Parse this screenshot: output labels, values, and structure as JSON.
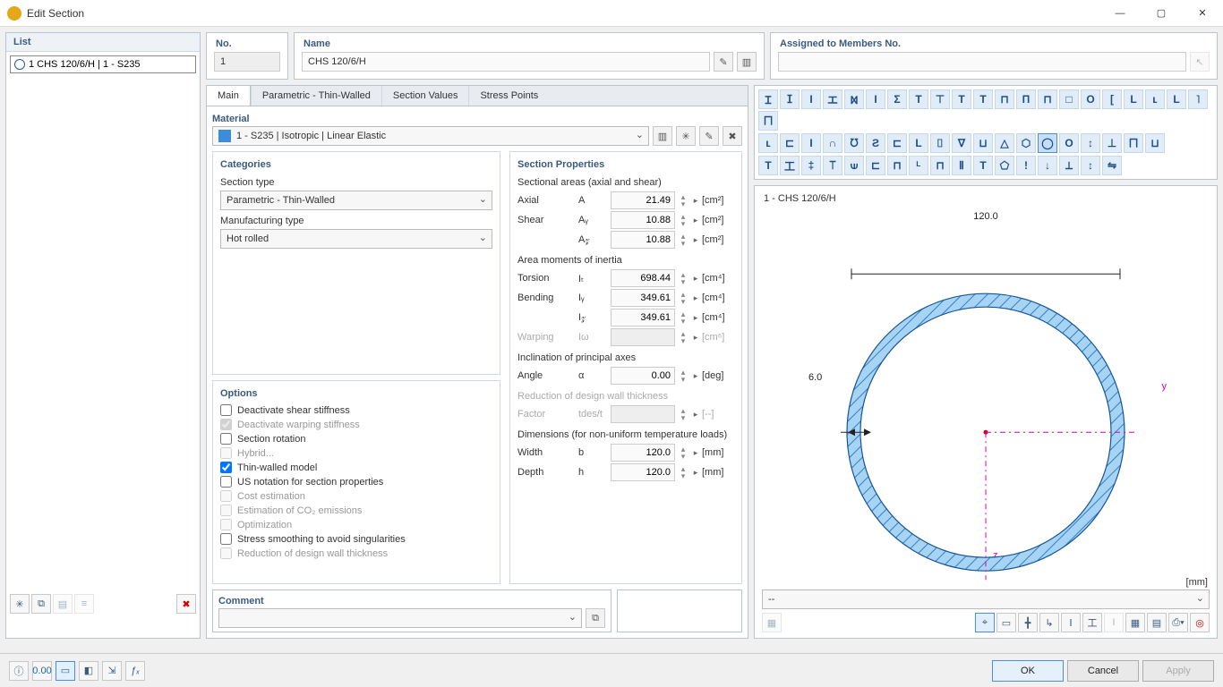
{
  "window": {
    "title": "Edit Section"
  },
  "list": {
    "header": "List",
    "items": [
      "1   CHS 120/6/H | 1 - S235"
    ]
  },
  "no": {
    "label": "No.",
    "value": "1"
  },
  "name": {
    "label": "Name",
    "value": "CHS 120/6/H"
  },
  "assigned": {
    "label": "Assigned to Members No.",
    "value": ""
  },
  "tabs": [
    "Main",
    "Parametric - Thin-Walled",
    "Section Values",
    "Stress Points"
  ],
  "material": {
    "header": "Material",
    "value": "1 - S235 | Isotropic | Linear Elastic"
  },
  "categories": {
    "header": "Categories",
    "section_type": {
      "label": "Section type",
      "value": "Parametric - Thin-Walled"
    },
    "manufacturing": {
      "label": "Manufacturing type",
      "value": "Hot rolled"
    }
  },
  "options": {
    "header": "Options",
    "items": [
      {
        "label": "Deactivate shear stiffness",
        "checked": false,
        "enabled": true
      },
      {
        "label": "Deactivate warping stiffness",
        "checked": true,
        "enabled": false
      },
      {
        "label": "Section rotation",
        "checked": false,
        "enabled": true
      },
      {
        "label": "Hybrid...",
        "checked": false,
        "enabled": false
      },
      {
        "label": "Thin-walled model",
        "checked": true,
        "enabled": true
      },
      {
        "label": "US notation for section properties",
        "checked": false,
        "enabled": true
      },
      {
        "label": "Cost estimation",
        "checked": false,
        "enabled": false
      },
      {
        "label": "Estimation of CO₂ emissions",
        "checked": false,
        "enabled": false
      },
      {
        "label": "Optimization",
        "checked": false,
        "enabled": false
      },
      {
        "label": "Stress smoothing to avoid singularities",
        "checked": false,
        "enabled": true
      },
      {
        "label": "Reduction of design wall thickness",
        "checked": false,
        "enabled": false
      }
    ]
  },
  "properties": {
    "header": "Section Properties",
    "groups": {
      "areas": {
        "title": "Sectional areas (axial and shear)",
        "rows": [
          {
            "label": "Axial",
            "sym": "A",
            "value": "21.49",
            "unit": "[cm²]"
          },
          {
            "label": "Shear",
            "sym": "Aᵧ",
            "value": "10.88",
            "unit": "[cm²]"
          },
          {
            "label": "",
            "sym": "A𝓏",
            "value": "10.88",
            "unit": "[cm²]"
          }
        ]
      },
      "inertia": {
        "title": "Area moments of inertia",
        "rows": [
          {
            "label": "Torsion",
            "sym": "Iₜ",
            "value": "698.44",
            "unit": "[cm⁴]"
          },
          {
            "label": "Bending",
            "sym": "Iᵧ",
            "value": "349.61",
            "unit": "[cm⁴]"
          },
          {
            "label": "",
            "sym": "I𝓏",
            "value": "349.61",
            "unit": "[cm⁴]"
          },
          {
            "label": "Warping",
            "sym": "Iω",
            "value": "",
            "unit": "[cm⁶]",
            "faded": true
          }
        ]
      },
      "inclination": {
        "title": "Inclination of principal axes",
        "rows": [
          {
            "label": "Angle",
            "sym": "α",
            "value": "0.00",
            "unit": "[deg]"
          }
        ]
      },
      "reduction": {
        "title": "Reduction of design wall thickness",
        "faded": true,
        "rows": [
          {
            "label": "Factor",
            "sym": "tdes/t",
            "value": "",
            "unit": "[--]",
            "faded": true
          }
        ]
      },
      "dimensions": {
        "title": "Dimensions (for non-uniform temperature loads)",
        "rows": [
          {
            "label": "Width",
            "sym": "b",
            "value": "120.0",
            "unit": "[mm]"
          },
          {
            "label": "Depth",
            "sym": "h",
            "value": "120.0",
            "unit": "[mm]"
          }
        ]
      }
    }
  },
  "comment": {
    "header": "Comment",
    "value": ""
  },
  "preview": {
    "title": "1 - CHS 120/6/H",
    "width_label": "120.0",
    "thickness_label": "6.0",
    "y": "y",
    "z": "z",
    "unit": "[mm]",
    "dropdown": "--"
  },
  "shapes_row1": [
    "Ɪ",
    "ⵊ",
    "I",
    "エ",
    "Ⳮ",
    "I",
    "Σ",
    "T",
    "⊤",
    "T",
    "T",
    "⊓",
    "Π",
    "⊓",
    "□",
    "O",
    "[",
    "L",
    "ʟ",
    "L",
    "˥",
    "⨅"
  ],
  "shapes_row2": [
    "ʟ",
    "⊏",
    "I",
    "∩",
    "ᘮ",
    "Ƨ",
    "⊏",
    "L",
    "⌷",
    "∇",
    "⊔",
    "△",
    "⬡",
    "◯",
    "O",
    "↕",
    "⊥",
    "⨅",
    "⊔"
  ],
  "shapes_row3": [
    "T",
    "工",
    "‡",
    "⟙",
    "⟒",
    "⊏",
    "⊓",
    "ᴸ",
    "⊓",
    "Ⅱ",
    "T",
    "⬠",
    "!",
    "↓",
    "⟂",
    "↕",
    "⇋"
  ],
  "buttons": {
    "ok": "OK",
    "cancel": "Cancel",
    "apply": "Apply"
  }
}
